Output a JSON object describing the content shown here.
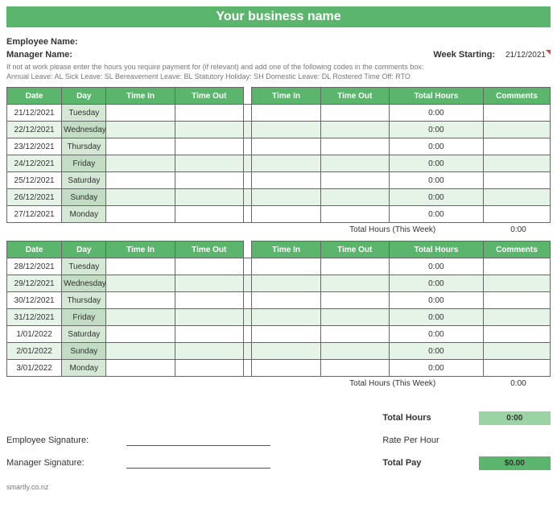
{
  "title": "Your business name",
  "labels": {
    "employee_name": "Employee Name:",
    "manager_name": "Manager Name:",
    "week_starting": "Week Starting:",
    "week_starting_value": "21/12/2021",
    "instructions": "If not at work please enter the hours you require payment for (if relevant) and add one of the following codes in the comments box:",
    "codes": "Annual Leave: AL    Sick Leave: SL    Bereavement Leave: BL    Statutory Holiday: SH    Domestic Leave: DL    Rostered Time Off: RTO"
  },
  "headers": {
    "date": "Date",
    "day": "Day",
    "time_in": "Time In",
    "time_out": "Time Out",
    "total_hours": "Total Hours",
    "comments": "Comments"
  },
  "week1": [
    {
      "date": "21/12/2021",
      "day": "Tuesday",
      "total": "0:00"
    },
    {
      "date": "22/12/2021",
      "day": "Wednesday",
      "total": "0:00"
    },
    {
      "date": "23/12/2021",
      "day": "Thursday",
      "total": "0:00"
    },
    {
      "date": "24/12/2021",
      "day": "Friday",
      "total": "0:00"
    },
    {
      "date": "25/12/2021",
      "day": "Saturday",
      "total": "0:00"
    },
    {
      "date": "26/12/2021",
      "day": "Sunday",
      "total": "0:00"
    },
    {
      "date": "27/12/2021",
      "day": "Monday",
      "total": "0:00"
    }
  ],
  "week2": [
    {
      "date": "28/12/2021",
      "day": "Tuesday",
      "total": "0:00"
    },
    {
      "date": "29/12/2021",
      "day": "Wednesday",
      "total": "0:00"
    },
    {
      "date": "30/12/2021",
      "day": "Thursday",
      "total": "0:00"
    },
    {
      "date": "31/12/2021",
      "day": "Friday",
      "total": "0:00"
    },
    {
      "date": "1/01/2022",
      "day": "Saturday",
      "total": "0:00"
    },
    {
      "date": "2/01/2022",
      "day": "Sunday",
      "total": "0:00"
    },
    {
      "date": "3/01/2022",
      "day": "Monday",
      "total": "0:00"
    }
  ],
  "week_total_label": "Total Hours (This Week)",
  "week_total_value": "0:00",
  "summary": {
    "total_hours_label": "Total Hours",
    "total_hours_value": "0:00",
    "rate_label": "Rate Per Hour",
    "rate_value": "",
    "total_pay_label": "Total Pay",
    "total_pay_value": "$0.00",
    "employee_sig": "Employee Signature:",
    "manager_sig": "Manager Signature:"
  },
  "footer": "smartly.co.nz"
}
